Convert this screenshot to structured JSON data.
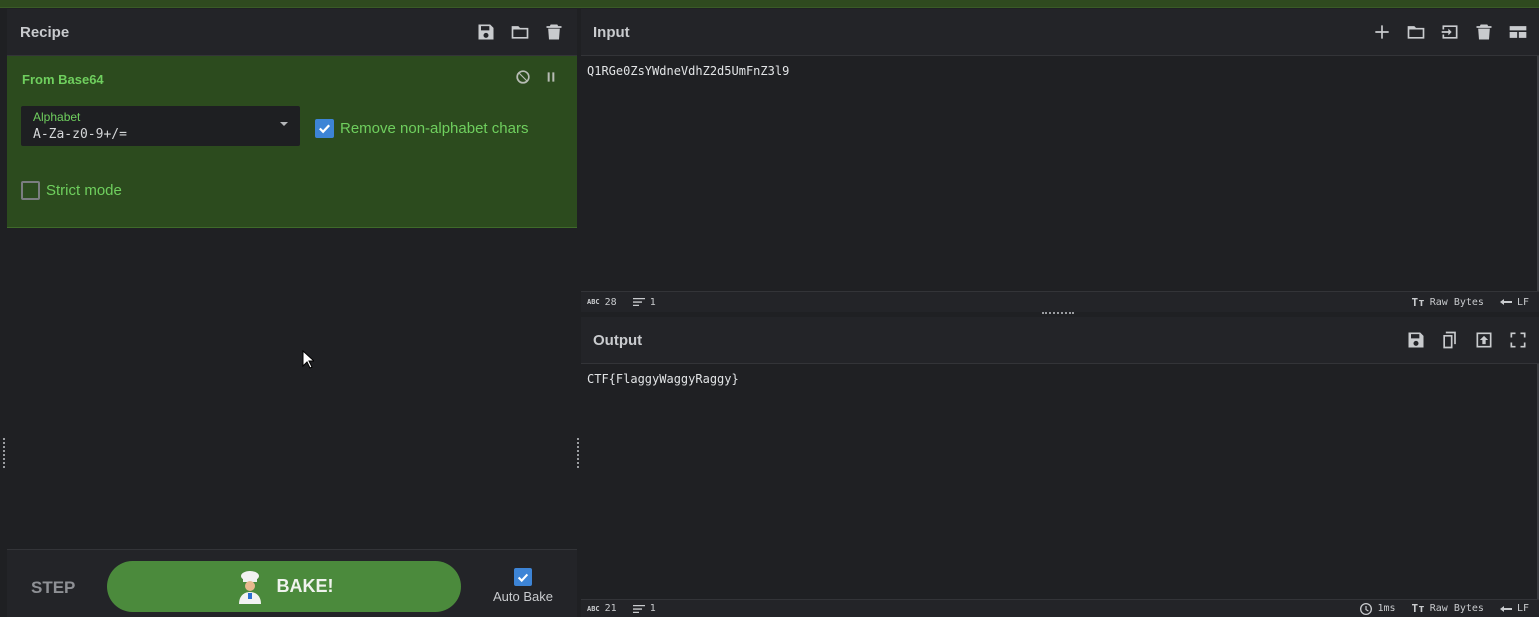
{
  "recipe": {
    "title": "Recipe",
    "operation": {
      "name": "From Base64",
      "alphabet_label": "Alphabet",
      "alphabet_value": "A-Za-z0-9+/=",
      "remove_nonalpha_label": "Remove non-alphabet chars",
      "remove_nonalpha_checked": true,
      "strict_label": "Strict mode",
      "strict_checked": false
    },
    "step_label": "STEP",
    "bake_label": "BAKE!",
    "auto_bake_label": "Auto Bake",
    "auto_bake_checked": true
  },
  "input": {
    "title": "Input",
    "text": "Q1RGe0ZsYWdneVdhZ2d5UmFnZ3l9",
    "status": {
      "chars": "28",
      "lines": "1",
      "encoding": "Raw Bytes",
      "eol": "LF"
    }
  },
  "output": {
    "title": "Output",
    "text": "CTF{FlaggyWaggyRaggy}",
    "status": {
      "chars": "21",
      "lines": "1",
      "time": "1ms",
      "encoding": "Raw Bytes",
      "eol": "LF"
    }
  },
  "colors": {
    "accent_green": "#6fcf5e",
    "bake_green": "#4b8a3c",
    "op_bg": "#2c4b1e",
    "check_blue": "#3d84d6"
  },
  "icons": [
    "save-icon",
    "folder-icon",
    "trash-icon",
    "plus-icon",
    "import-icon",
    "layout-icon",
    "copy-icon",
    "replace-input-icon",
    "maximize-icon",
    "disable-icon",
    "pause-icon",
    "chef-icon",
    "clock-icon",
    "text-icon",
    "lines-icon",
    "newline-icon"
  ]
}
